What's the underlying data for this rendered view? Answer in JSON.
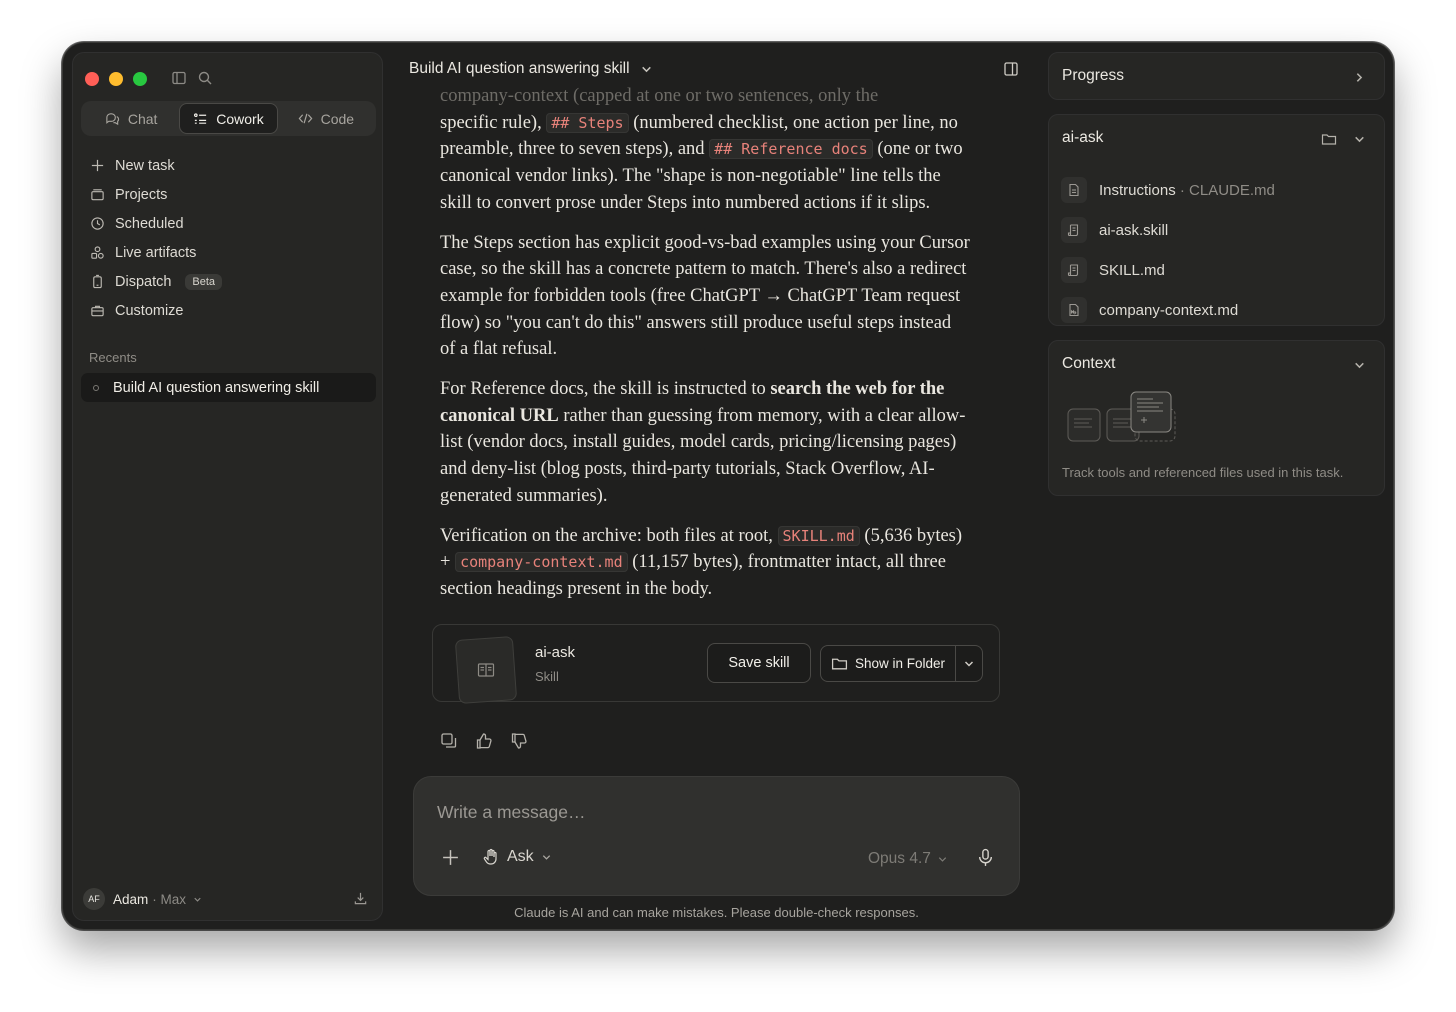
{
  "sidebar": {
    "modes": [
      {
        "label": "Chat",
        "icon": "chat-bubbles-icon"
      },
      {
        "label": "Cowork",
        "icon": "list-checks-icon"
      },
      {
        "label": "Code",
        "icon": "code-brackets-icon"
      }
    ],
    "nav": [
      {
        "label": "New task",
        "icon": "plus-icon"
      },
      {
        "label": "Projects",
        "icon": "folder-stack-icon"
      },
      {
        "label": "Scheduled",
        "icon": "clock-icon"
      },
      {
        "label": "Live artifacts",
        "icon": "shapes-icon"
      },
      {
        "label": "Dispatch",
        "icon": "phone-icon",
        "badge": "Beta"
      },
      {
        "label": "Customize",
        "icon": "briefcase-icon"
      }
    ],
    "recents_label": "Recents",
    "recents": [
      {
        "label": "Build AI question answering skill"
      }
    ],
    "user": {
      "initials": "AF",
      "name": "Adam",
      "plan": "· Max"
    }
  },
  "main": {
    "title": "Build AI question answering skill",
    "message": {
      "p1_fragments": {
        "faded_top": "company-context (capped at one or two sentences, only the",
        "lead": "specific rule), ",
        "code_steps": "## Steps",
        "mid1": " (numbered checklist, one action per line, no preamble, three to seven steps), and ",
        "code_ref": "## Reference docs",
        "tail": " (one or two canonical vendor links). The \"shape is non-negotiable\" line tells the skill to convert prose under Steps into numbered actions if it slips."
      },
      "p2": "The Steps section has explicit good-vs-bad examples using your Cursor case, so the skill has a concrete pattern to match. There's also a redirect example for forbidden tools (free ChatGPT → ChatGPT Team request flow) so \"you can't do this\" answers still produce useful steps instead of a flat refusal.",
      "p3_fragments": {
        "lead": "For Reference docs, the skill is instructed to ",
        "bold": "search the web for the canonical URL",
        "tail": " rather than guessing from memory, with a clear allow-list (vendor docs, install guides, model cards, pricing/licensing pages) and deny-list (blog posts, third-party tutorials, Stack Overflow, AI-generated summaries)."
      },
      "p4_fragments": {
        "lead": "Verification on the archive: both files at root, ",
        "code1": "SKILL.md",
        "mid1": " (5,636 bytes) + ",
        "code2": "company-context.md",
        "tail": " (11,157 bytes), frontmatter intact, all three section headings present in the body."
      }
    },
    "skill_card": {
      "name": "ai-ask",
      "type": "Skill",
      "save_label": "Save skill",
      "folder_label": "Show in Folder"
    },
    "composer": {
      "placeholder": "Write a message…",
      "mode": "Ask",
      "model": "Opus 4.7"
    },
    "disclaimer": "Claude is AI and can make mistakes. Please double-check responses."
  },
  "right": {
    "progress_title": "Progress",
    "folder_title": "ai-ask",
    "files": [
      {
        "name": "Instructions",
        "sub": " · CLAUDE.md",
        "icon": "document-icon"
      },
      {
        "name": "ai-ask.skill",
        "sub": "",
        "icon": "scroll-icon"
      },
      {
        "name": "SKILL.md",
        "sub": "",
        "icon": "scroll-icon"
      },
      {
        "name": "company-context.md",
        "sub": "",
        "icon": "markdown-file-icon"
      }
    ],
    "context_title": "Context",
    "context_text": "Track tools and referenced files used in this task."
  }
}
